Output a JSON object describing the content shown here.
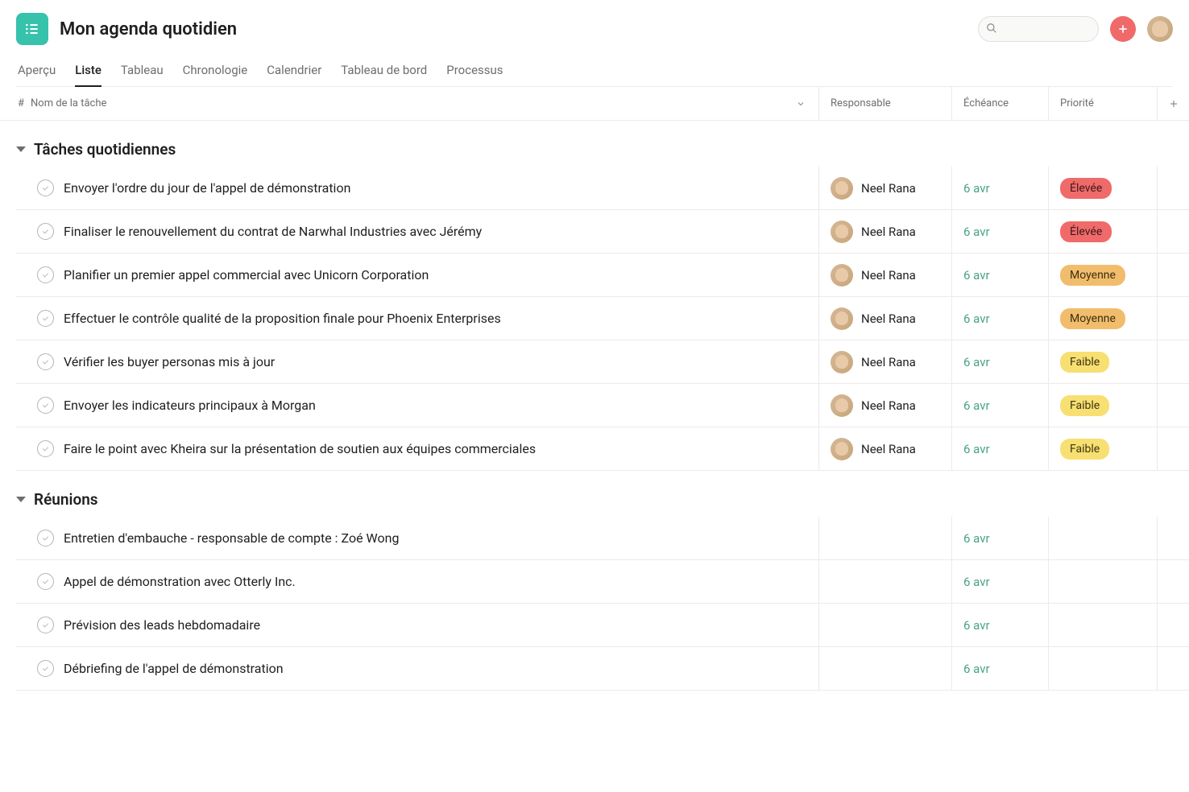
{
  "project": {
    "title": "Mon agenda quotidien"
  },
  "tabs": [
    {
      "label": "Aperçu",
      "active": false
    },
    {
      "label": "Liste",
      "active": true
    },
    {
      "label": "Tableau",
      "active": false
    },
    {
      "label": "Chronologie",
      "active": false
    },
    {
      "label": "Calendrier",
      "active": false
    },
    {
      "label": "Tableau de bord",
      "active": false
    },
    {
      "label": "Processus",
      "active": false
    }
  ],
  "columns": {
    "hash": "#",
    "name": "Nom de la tâche",
    "assignee": "Responsable",
    "due": "Échéance",
    "priority": "Priorité"
  },
  "search": {
    "placeholder": ""
  },
  "sections": [
    {
      "title": "Tâches quotidiennes",
      "tasks": [
        {
          "name": "Envoyer l'ordre du jour de l'appel de démonstration",
          "assignee": "Neel Rana",
          "due": "6 avr",
          "priority": "Élevée",
          "priorityLevel": "high"
        },
        {
          "name": "Finaliser le renouvellement du contrat de Narwhal Industries avec Jérémy",
          "assignee": "Neel Rana",
          "due": "6 avr",
          "priority": "Élevée",
          "priorityLevel": "high"
        },
        {
          "name": "Planifier un premier appel commercial avec Unicorn Corporation",
          "assignee": "Neel Rana",
          "due": "6 avr",
          "priority": "Moyenne",
          "priorityLevel": "medium"
        },
        {
          "name": "Effectuer le contrôle qualité de la proposition finale pour Phoenix Enterprises",
          "assignee": "Neel Rana",
          "due": "6 avr",
          "priority": "Moyenne",
          "priorityLevel": "medium"
        },
        {
          "name": "Vérifier les buyer personas mis à jour",
          "assignee": "Neel Rana",
          "due": "6 avr",
          "priority": "Faible",
          "priorityLevel": "low"
        },
        {
          "name": "Envoyer les indicateurs principaux à Morgan",
          "assignee": "Neel Rana",
          "due": "6 avr",
          "priority": "Faible",
          "priorityLevel": "low"
        },
        {
          "name": "Faire le point avec Kheira sur la présentation de soutien aux équipes commerciales",
          "assignee": "Neel Rana",
          "due": "6 avr",
          "priority": "Faible",
          "priorityLevel": "low"
        }
      ]
    },
    {
      "title": "Réunions",
      "tasks": [
        {
          "name": "Entretien d'embauche - responsable de compte : Zoé Wong",
          "assignee": "",
          "due": "6 avr",
          "priority": "",
          "priorityLevel": ""
        },
        {
          "name": "Appel de démonstration avec Otterly Inc.",
          "assignee": "",
          "due": "6 avr",
          "priority": "",
          "priorityLevel": ""
        },
        {
          "name": "Prévision des leads hebdomadaire",
          "assignee": "",
          "due": "6 avr",
          "priority": "",
          "priorityLevel": ""
        },
        {
          "name": "Débriefing de l'appel de démonstration",
          "assignee": "",
          "due": "6 avr",
          "priority": "",
          "priorityLevel": ""
        }
      ]
    }
  ],
  "colors": {
    "accent": "#37c2ac",
    "addBtn": "#f06a6a",
    "dueText": "#4aa387",
    "priorityHigh": "#f06a6a",
    "priorityMedium": "#f1bd6c",
    "priorityLow": "#f8df72"
  }
}
